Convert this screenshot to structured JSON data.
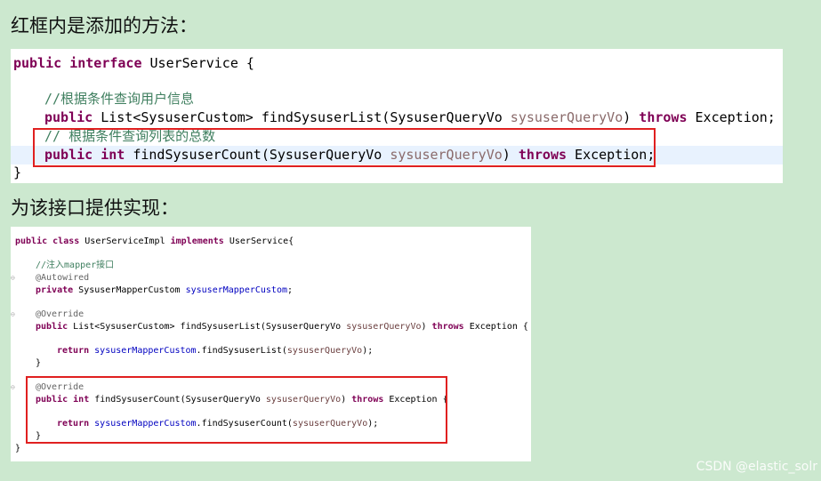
{
  "heading1": "红框内是添加的方法：",
  "heading2": "为该接口提供实现：",
  "interface_code": {
    "line1": {
      "kw1": "public",
      "kw2": "interface",
      "rest": " UserService {"
    },
    "line3": {
      "comment": "//根据条件查询用户信息"
    },
    "line4": {
      "kw1": "public",
      "mid": " List<SysuserCustom> findSysuserList(SysuserQueryVo ",
      "param": "sysuserQueryVo",
      "mid2": ") ",
      "kw2": "throws",
      "tail": " Exception;"
    },
    "line5": {
      "comment": "// 根据条件查询列表的总数"
    },
    "line6": {
      "kw1": "public",
      "kw2": "int",
      "mid": " findSysuserCount(SysuserQueryVo ",
      "param": "sysuserQueryVo",
      "mid2": ") ",
      "kw3": "throws",
      "tail": " Exception;"
    },
    "line7": {
      "brace": "}"
    }
  },
  "impl_code": {
    "line1": {
      "kw1": "public",
      "kw2": "class",
      "mid": " UserServiceImpl ",
      "kw3": "implements",
      "tail": " UserService{"
    },
    "line3": {
      "comment": "//注入mapper接口"
    },
    "line4": {
      "annot": "@Autowired"
    },
    "line5": {
      "kw1": "private",
      "mid": " SysuserMapperCustom ",
      "field": "sysuserMapperCustom",
      "tail": ";"
    },
    "line7": {
      "annot": "@Override"
    },
    "line8": {
      "kw1": "public",
      "mid": " List<SysuserCustom> findSysuserList(SysuserQueryVo ",
      "param": "sysuserQueryVo",
      "mid2": ") ",
      "kw2": "throws",
      "tail": " Exception {"
    },
    "line10": {
      "kw1": "return",
      "field": "sysuserMapperCustom",
      "mid": ".findSysuserList(",
      "param": "sysuserQueryVo",
      "tail": ");"
    },
    "line11": {
      "brace": "}"
    },
    "line13": {
      "annot": "@Override"
    },
    "line14": {
      "kw1": "public",
      "kw2": "int",
      "mid": " findSysuserCount(SysuserQueryVo ",
      "param": "sysuserQueryVo",
      "mid2": ") ",
      "kw3": "throws",
      "tail": " Exception {"
    },
    "line16": {
      "kw1": "return",
      "field": "sysuserMapperCustom",
      "mid": ".findSysuserCount(",
      "param": "sysuserQueryVo",
      "tail": ");"
    },
    "line17": {
      "brace": "}"
    },
    "line18": {
      "brace": "}"
    }
  },
  "watermark": "CSDN @elastic_solr"
}
